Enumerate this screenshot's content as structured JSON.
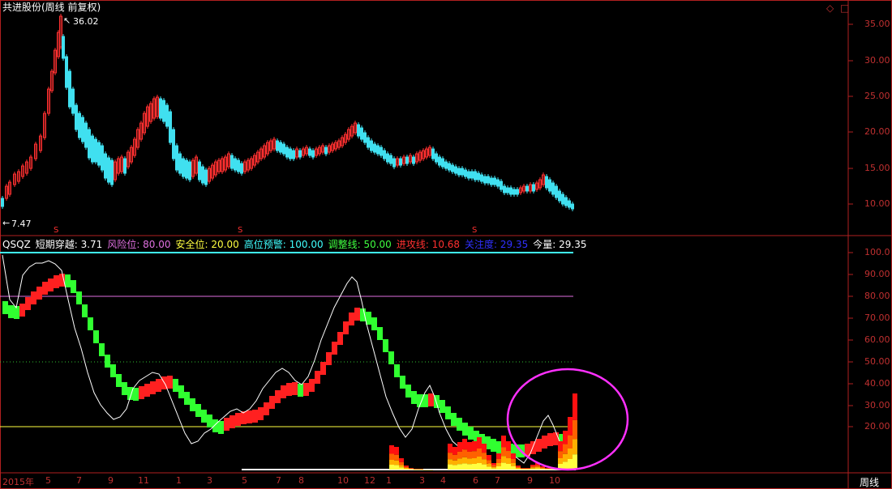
{
  "title": "共进股份(周线 前复权)",
  "price_high_label": "36.02",
  "price_low_label": "7.47",
  "controls": {
    "diamond": "◇",
    "box": "□"
  },
  "period_label": "周线",
  "indicator_legend": [
    {
      "key": "name",
      "text": "QSQZ",
      "color": "#ffffff"
    },
    {
      "key": "short",
      "text": "短期穿越: 3.71",
      "color": "#ffffff"
    },
    {
      "key": "risk",
      "text": "风险位: 80.00",
      "color": "#e070e0"
    },
    {
      "key": "safe",
      "text": "安全位: 20.00",
      "color": "#ffff40"
    },
    {
      "key": "warn",
      "text": "高位预警: 100.00",
      "color": "#40ffff"
    },
    {
      "key": "adjust",
      "text": "调整线: 50.00",
      "color": "#40ff40"
    },
    {
      "key": "attack",
      "text": "进攻线: 10.68",
      "color": "#ff3030"
    },
    {
      "key": "focus",
      "text": "关注度: 29.35",
      "color": "#3030ff"
    },
    {
      "key": "vol",
      "text": "今量: 29.35",
      "color": "#ffffff"
    }
  ],
  "price_axis": [
    "35.00",
    "30.00",
    "25.00",
    "20.00",
    "15.00",
    "10.00"
  ],
  "indicator_axis": [
    "100.0",
    "90.00",
    "80.00",
    "70.00",
    "60.00",
    "50.00",
    "40.00",
    "30.00",
    "20.00"
  ],
  "x_axis": [
    "2015年",
    "5",
    "7",
    "9",
    "11",
    "1",
    "3",
    "5",
    "7",
    "8",
    "10",
    "12",
    "1",
    "3",
    "4",
    "6",
    "7",
    "9",
    "10"
  ],
  "s_marks": [
    "S",
    "S",
    "S"
  ],
  "colors": {
    "up": "#ff3030",
    "down": "#40e0f0",
    "attack": "#ff2020",
    "adjust": "#30ff30",
    "axis": "#b02020"
  }
}
